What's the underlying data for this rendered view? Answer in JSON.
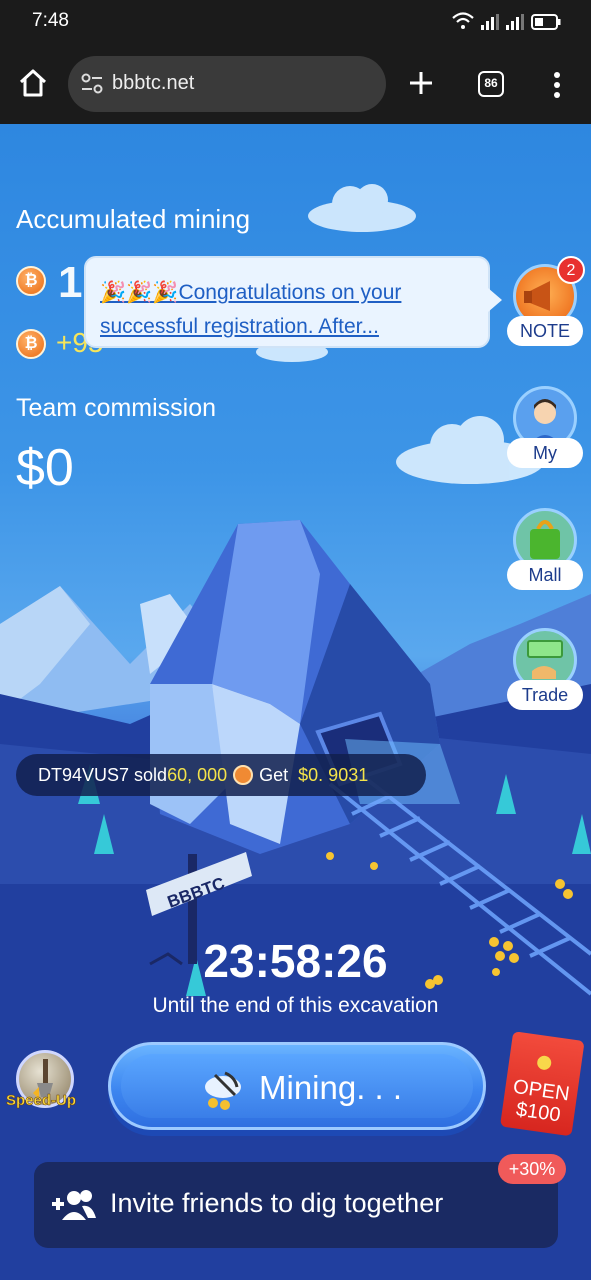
{
  "status_bar": {
    "time": "7:48"
  },
  "browser": {
    "url": "bbbtc.net",
    "tab_count": "86"
  },
  "mining": {
    "accumulated_label": "Accumulated mining",
    "accumulated_value": "1",
    "per_day": "+95",
    "coin_symbol": "₿"
  },
  "notice": {
    "line1": "🎉🎉🎉Congratulations on your",
    "line2": "successful registration.  After..."
  },
  "team": {
    "label": "Team commission",
    "value": "$0"
  },
  "side_menu": [
    {
      "label": "NOTE",
      "badge": "2"
    },
    {
      "label": "My"
    },
    {
      "label": "Mall"
    },
    {
      "label": "Trade"
    }
  ],
  "ticker": {
    "user": "DT94VUS7 sold",
    "amount": "60, 000",
    "get": "Get",
    "price": "$0. 9031"
  },
  "sign_text": "BBBTC",
  "countdown": {
    "time": "23:58:26",
    "caption": "Until the end of this excavation"
  },
  "speed_up": {
    "label": "Speed-Up"
  },
  "mining_button": {
    "label": "Mining. . ."
  },
  "red_packet": {
    "line1": "OPEN",
    "line2": "$100"
  },
  "invite": {
    "label": "Invite friends to dig together",
    "bonus": "+30%"
  }
}
